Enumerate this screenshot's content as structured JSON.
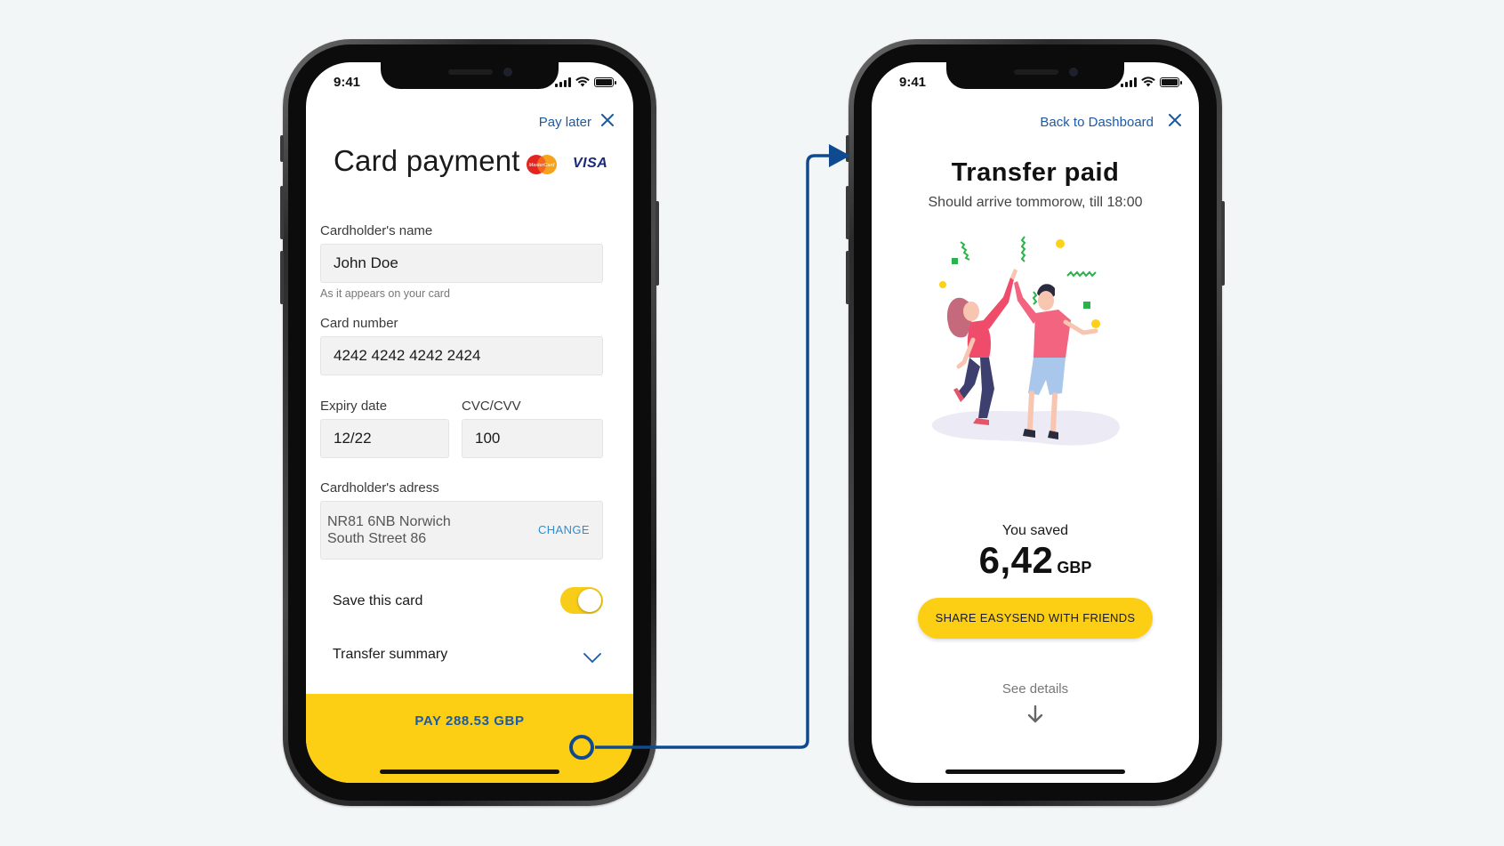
{
  "left_screen": {
    "status_time": "9:41",
    "pay_later_label": "Pay later",
    "title": "Card payment",
    "card_brands": {
      "mastercard_text": "MasterCard",
      "visa_text": "VISA"
    },
    "cardholder_name": {
      "label": "Cardholder's name",
      "value": "John Doe",
      "hint": "As it appears on your card"
    },
    "card_number": {
      "label": "Card number",
      "value": "4242 4242 4242 2424"
    },
    "expiry_date": {
      "label": "Expiry date",
      "value": "12/22"
    },
    "cvc": {
      "label": "CVC/CVV",
      "value": "100"
    },
    "address": {
      "label": "Cardholder's adress",
      "line1": "NR81 6NB Norwich",
      "line2": "South Street 86",
      "change_label": "CHANGE"
    },
    "save_card": {
      "label": "Save this card",
      "enabled": true
    },
    "transfer_summary_label": "Transfer summary",
    "pay_button_label": "PAY 288.53 GBP"
  },
  "right_screen": {
    "status_time": "9:41",
    "back_label": "Back to Dashboard",
    "title": "Transfer paid",
    "subtitle": "Should arrive tommorow, till 18:00",
    "saved_label": "You saved",
    "saved_amount": "6,42",
    "saved_currency": "GBP",
    "share_button_label": "SHARE EASYSEND WITH FRIENDS",
    "see_details_label": "See details"
  },
  "colors": {
    "accent_yellow": "#fccf15",
    "link_blue": "#1b5aa5",
    "change_blue": "#2a8fd6",
    "connector_blue": "#0f4a90"
  }
}
